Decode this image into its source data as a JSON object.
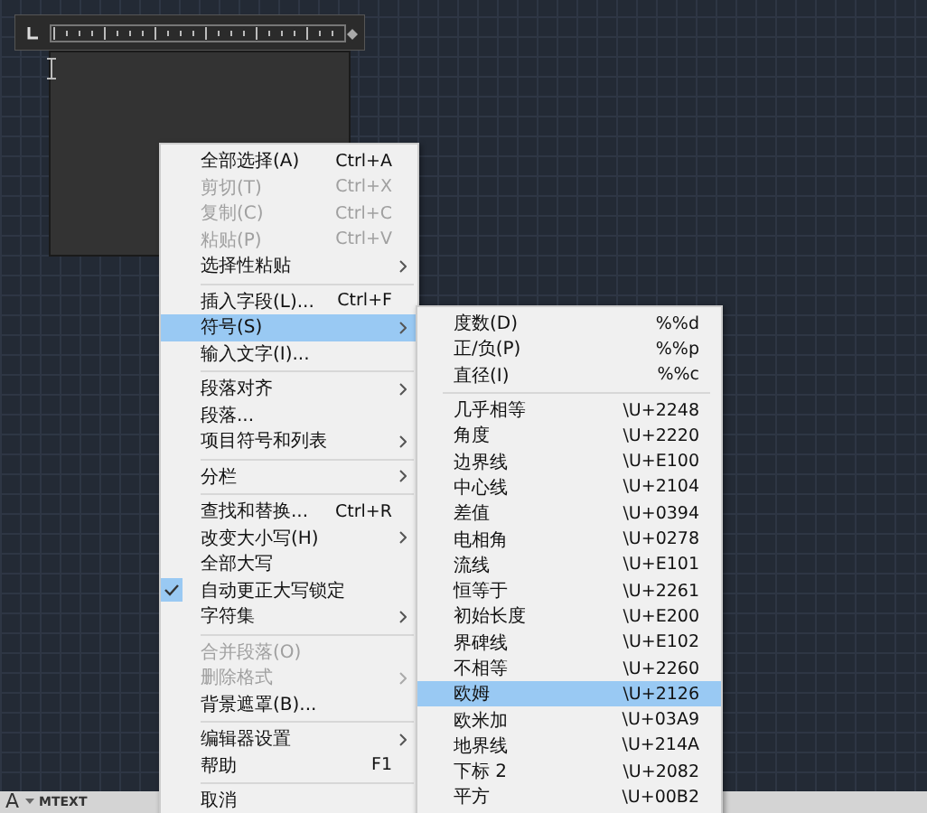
{
  "status_bar": {
    "icon_text": "A",
    "label": "MTEXT"
  },
  "context_menu": {
    "items": [
      {
        "kind": "item",
        "label": "全部选择(A)",
        "shortcut": "Ctrl+A",
        "disabled": false,
        "has_submenu": false,
        "checked": false,
        "selected": false
      },
      {
        "kind": "item",
        "label": "剪切(T)",
        "shortcut": "Ctrl+X",
        "disabled": true,
        "has_submenu": false,
        "checked": false,
        "selected": false
      },
      {
        "kind": "item",
        "label": "复制(C)",
        "shortcut": "Ctrl+C",
        "disabled": true,
        "has_submenu": false,
        "checked": false,
        "selected": false
      },
      {
        "kind": "item",
        "label": "粘贴(P)",
        "shortcut": "Ctrl+V",
        "disabled": true,
        "has_submenu": false,
        "checked": false,
        "selected": false
      },
      {
        "kind": "item",
        "label": "选择性粘贴",
        "disabled": false,
        "has_submenu": true,
        "checked": false,
        "selected": false
      },
      {
        "kind": "divider"
      },
      {
        "kind": "item",
        "label": "插入字段(L)...",
        "shortcut": "Ctrl+F",
        "disabled": false,
        "has_submenu": false,
        "checked": false,
        "selected": false
      },
      {
        "kind": "item",
        "label": "符号(S)",
        "disabled": false,
        "has_submenu": true,
        "checked": false,
        "selected": true
      },
      {
        "kind": "item",
        "label": "输入文字(I)...",
        "disabled": false,
        "has_submenu": false,
        "checked": false,
        "selected": false
      },
      {
        "kind": "divider"
      },
      {
        "kind": "item",
        "label": "段落对齐",
        "disabled": false,
        "has_submenu": true,
        "checked": false,
        "selected": false
      },
      {
        "kind": "item",
        "label": "段落...",
        "disabled": false,
        "has_submenu": false,
        "checked": false,
        "selected": false
      },
      {
        "kind": "item",
        "label": "项目符号和列表",
        "disabled": false,
        "has_submenu": true,
        "checked": false,
        "selected": false
      },
      {
        "kind": "divider"
      },
      {
        "kind": "item",
        "label": "分栏",
        "disabled": false,
        "has_submenu": true,
        "checked": false,
        "selected": false
      },
      {
        "kind": "divider"
      },
      {
        "kind": "item",
        "label": "查找和替换...",
        "shortcut": "Ctrl+R",
        "disabled": false,
        "has_submenu": false,
        "checked": false,
        "selected": false
      },
      {
        "kind": "item",
        "label": "改变大小写(H)",
        "disabled": false,
        "has_submenu": true,
        "checked": false,
        "selected": false
      },
      {
        "kind": "item",
        "label": "全部大写",
        "disabled": false,
        "has_submenu": false,
        "checked": false,
        "selected": false
      },
      {
        "kind": "item",
        "label": "自动更正大写锁定",
        "disabled": false,
        "has_submenu": false,
        "checked": true,
        "selected": false
      },
      {
        "kind": "item",
        "label": "字符集",
        "disabled": false,
        "has_submenu": true,
        "checked": false,
        "selected": false
      },
      {
        "kind": "divider"
      },
      {
        "kind": "item",
        "label": "合并段落(O)",
        "disabled": true,
        "has_submenu": false,
        "checked": false,
        "selected": false
      },
      {
        "kind": "item",
        "label": "删除格式",
        "disabled": true,
        "has_submenu": true,
        "checked": false,
        "selected": false
      },
      {
        "kind": "item",
        "label": "背景遮罩(B)...",
        "disabled": false,
        "has_submenu": false,
        "checked": false,
        "selected": false
      },
      {
        "kind": "divider"
      },
      {
        "kind": "item",
        "label": "编辑器设置",
        "disabled": false,
        "has_submenu": true,
        "checked": false,
        "selected": false
      },
      {
        "kind": "item",
        "label": "帮助",
        "shortcut": "F1",
        "disabled": false,
        "has_submenu": false,
        "checked": false,
        "selected": false
      },
      {
        "kind": "divider"
      },
      {
        "kind": "item",
        "label": "取消",
        "disabled": false,
        "has_submenu": false,
        "checked": false,
        "selected": false
      }
    ]
  },
  "symbol_submenu": {
    "items": [
      {
        "kind": "item",
        "label": "度数(D)",
        "code": "%%d",
        "selected": false
      },
      {
        "kind": "item",
        "label": "正/负(P)",
        "code": "%%p",
        "selected": false
      },
      {
        "kind": "item",
        "label": "直径(I)",
        "code": "%%c",
        "selected": false
      },
      {
        "kind": "divider"
      },
      {
        "kind": "item",
        "label": "几乎相等",
        "code": "\\U+2248",
        "selected": false
      },
      {
        "kind": "item",
        "label": "角度",
        "code": "\\U+2220",
        "selected": false
      },
      {
        "kind": "item",
        "label": "边界线",
        "code": "\\U+E100",
        "selected": false
      },
      {
        "kind": "item",
        "label": "中心线",
        "code": "\\U+2104",
        "selected": false
      },
      {
        "kind": "item",
        "label": "差值",
        "code": "\\U+0394",
        "selected": false
      },
      {
        "kind": "item",
        "label": "电相角",
        "code": "\\U+0278",
        "selected": false
      },
      {
        "kind": "item",
        "label": "流线",
        "code": "\\U+E101",
        "selected": false
      },
      {
        "kind": "item",
        "label": "恒等于",
        "code": "\\U+2261",
        "selected": false
      },
      {
        "kind": "item",
        "label": "初始长度",
        "code": "\\U+E200",
        "selected": false
      },
      {
        "kind": "item",
        "label": "界碑线",
        "code": "\\U+E102",
        "selected": false
      },
      {
        "kind": "item",
        "label": "不相等",
        "code": "\\U+2260",
        "selected": false
      },
      {
        "kind": "item",
        "label": "欧姆",
        "code": "\\U+2126",
        "selected": true
      },
      {
        "kind": "item",
        "label": "欧米加",
        "code": "\\U+03A9",
        "selected": false
      },
      {
        "kind": "item",
        "label": "地界线",
        "code": "\\U+214A",
        "selected": false
      },
      {
        "kind": "item",
        "label": "下标 2",
        "code": "\\U+2082",
        "selected": false
      },
      {
        "kind": "item",
        "label": "平方",
        "code": "\\U+00B2",
        "selected": false
      }
    ]
  }
}
